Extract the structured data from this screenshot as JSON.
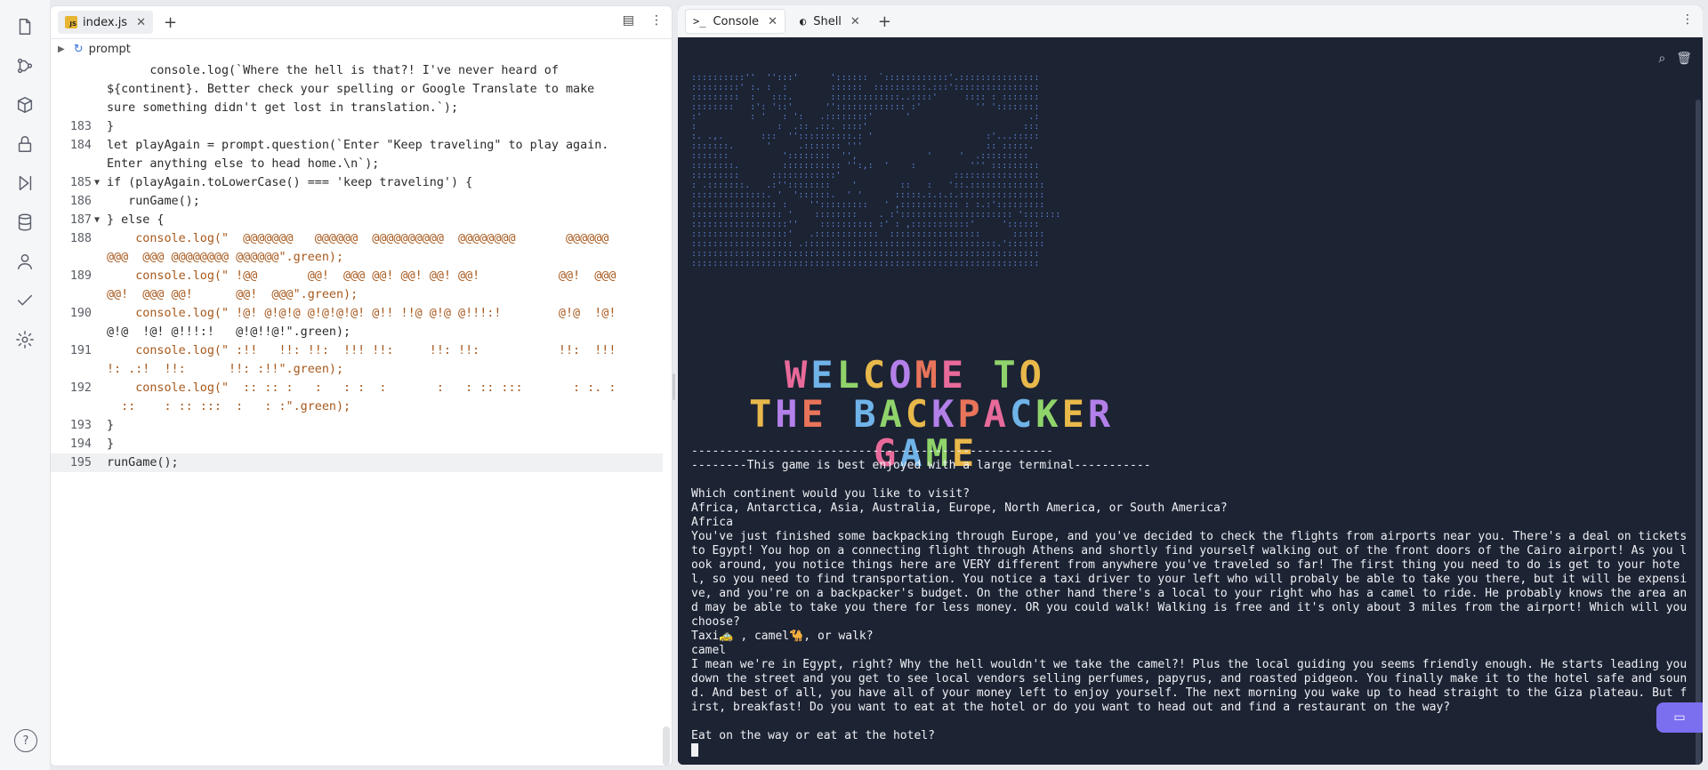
{
  "rail": {
    "icons": [
      "file-icon",
      "git-branch-icon",
      "cube-icon",
      "lock-icon",
      "run-icon",
      "database-icon",
      "user-icon",
      "check-icon",
      "settings-icon"
    ],
    "help_label": "?"
  },
  "editor": {
    "tab_label": "index.js",
    "tab_badge": "JS",
    "breadcrumb": "prompt",
    "code_lines": [
      {
        "ln": "",
        "fold": "",
        "text": "      console.log(`Where the hell is that?! I've never heard of"
      },
      {
        "ln": "",
        "fold": "",
        "text": "${continent}. Better check your spelling or Google Translate to make"
      },
      {
        "ln": "",
        "fold": "",
        "text": "sure something didn't get lost in translation.`);"
      },
      {
        "ln": "183",
        "fold": "",
        "text": "}"
      },
      {
        "ln": "184",
        "fold": "",
        "text": "let playAgain = prompt.question(`Enter \"Keep traveling\" to play again."
      },
      {
        "ln": "",
        "fold": "",
        "text": "Enter anything else to head home.\\n`);"
      },
      {
        "ln": "185",
        "fold": "▼",
        "text": "if (playAgain.toLowerCase() === 'keep traveling') {"
      },
      {
        "ln": "186",
        "fold": "",
        "text": "   runGame();"
      },
      {
        "ln": "187",
        "fold": "▼",
        "text": "} else {"
      },
      {
        "ln": "188",
        "fold": "",
        "text": "    console.log(\"  @@@@@@@   @@@@@@  @@@@@@@@@@  @@@@@@@@       @@@@@@"
      },
      {
        "ln": "",
        "fold": "",
        "text": "@@@  @@@ @@@@@@@@ @@@@@@\".green);"
      },
      {
        "ln": "189",
        "fold": "",
        "text": "    console.log(\" !@@       @@!  @@@ @@! @@! @@! @@!           @@!  @@@"
      },
      {
        "ln": "",
        "fold": "",
        "text": "@@!  @@@ @@!      @@!  @@@\".green);"
      },
      {
        "ln": "190",
        "fold": "",
        "text": "    console.log(\" !@! @!@!@ @!@!@!@! @!! !!@ @!@ @!!!:!        @!@  !@!"
      },
      {
        "ln": "",
        "fold": "",
        "text": "@!@  !@! @!!!:!   @!@!!@!\".green);"
      },
      {
        "ln": "191",
        "fold": "",
        "text": "    console.log(\" :!!   !!: !!:  !!! !!:     !!: !!:           !!:  !!!"
      },
      {
        "ln": "",
        "fold": "",
        "text": "!: .:!  !!:      !!: :!!\".green);"
      },
      {
        "ln": "192",
        "fold": "",
        "text": "    console.log(\"  :: :: :   :   : :  :       :   : :: :::       : :. :"
      },
      {
        "ln": "",
        "fold": "",
        "text": "  ::    : :: :::  :   : :\".green);"
      },
      {
        "ln": "193",
        "fold": "",
        "text": "}"
      },
      {
        "ln": "194",
        "fold": "",
        "text": "}"
      },
      {
        "ln": "195",
        "fold": "",
        "text": "runGame();"
      }
    ]
  },
  "console": {
    "tabs": [
      {
        "icon": ">_",
        "label": "Console"
      },
      {
        "icon": "◐",
        "label": "Shell"
      }
    ],
    "ascii_art": "::::::::::''  '':::'      '::::::  `::::::::::::'.:::::::::::::::\n:::::::::' :. :  :        ::::::  ::::::::::.:::'::::::::::::::::\n:::::::::  :   :::.       :::::::::::::..::::'     :::: : :::::::\n::::::::   :': '::'      ''::::::::::::: :'          '' '::::::::\n:'         : '   : ':   .::::::::'      '                      .:\n:               :  .:: .::. ::::'                             :::\n:. .,.       :::  ''::::::::::.: '                     :'...:::::\n:::::::.      '     .::::::: '''                       :: :::::.\n:::::::          '::::::::  '',             '     '  .:::::::::\n::::::::.        ::::::::::: '':,:  '    :          ''' :::::::::\n:::::::::      ::::::::::::'                     ::::::::::::::::\n: .:::::::.   .:''::::::::    '        ::   :   '::.::::::::::::::\n::::::::::::::. '  '::::::.  ' '      :::::.:.:.:.::::::::::::::::\n:::::::::::::::: :    '':::::::::   ' ,::::::::::: : :.:':::::::::\n::::::::::::::::: '    ::::::::    . :'::::::::::::::::::::: ':::::::\n::::::::::::::::::''    :::::::::: :' : ,:::::::::::'     '::::::\n::::::::::::::::::'   .::::::::::::  :::::::::::::::::      ::::::\n::::::::::::::::::: .::::::::::::::::::::::::::::::::::::.':::::::\n:::::::::::::::::::::::::::::::::::::::::::::::::::::::::::::::::\n:::::::::::::::::::::::::::::::::::::::::::::::::::::::::::::::::",
    "banner_lines": [
      "WELCOME TO",
      "THE BACKPACKER",
      "GAME"
    ],
    "banner_colors": [
      "#e86a9a",
      "#6fb3e8",
      "#8fd36a",
      "#e8b84a",
      "#b37fe8",
      "#e8745a"
    ],
    "output_lines": [
      "----------------------------------------------------",
      "--------This game is best enjoyed with a large terminal-----------",
      "",
      "Which continent would you like to visit?",
      "Africa, Antarctica, Asia, Australia, Europe, North America, or South America?",
      "Africa",
      "You've just finished some backpacking through Europe, and you've decided to check the flights from airports near you. There's a deal on tickets to Egypt! You hop on a connecting flight through Athens and shortly find yourself walking out of the front doors of the Cairo airport! As you look around, you notice things here are VERY different from anywhere you've traveled so far! The first thing you need to do is get to your hotel, so you need to find transportation. You notice a taxi driver to your left who will probaly be able to take you there, but it will be expensive, and you're on a backpacker's budget. On the other hand there's a local to your right who has a camel to ride. He probably knows the area and may be able to take you there for less money. OR you could walk! Walking is free and it's only about 3 miles from the airport! Which will you choose?",
      "Taxi🚕 , camel🐪, or walk?",
      "camel",
      "I mean we're in Egypt, right? Why the hell wouldn't we take the camel?! Plus the local guiding you seems friendly enough. He starts leading you down the street and you get to see local vendors selling perfumes, papyrus, and roasted pidgeon. You finally make it to the hotel safe and sound. And best of all, you have all of your money left to enjoy yourself. The next morning you wake up to head straight to the Giza plateau. But first, breakfast! Do you want to eat at the hotel or do you want to head out and find a restaurant on the way?",
      "",
      "Eat on the way or eat at the hotel?"
    ]
  }
}
